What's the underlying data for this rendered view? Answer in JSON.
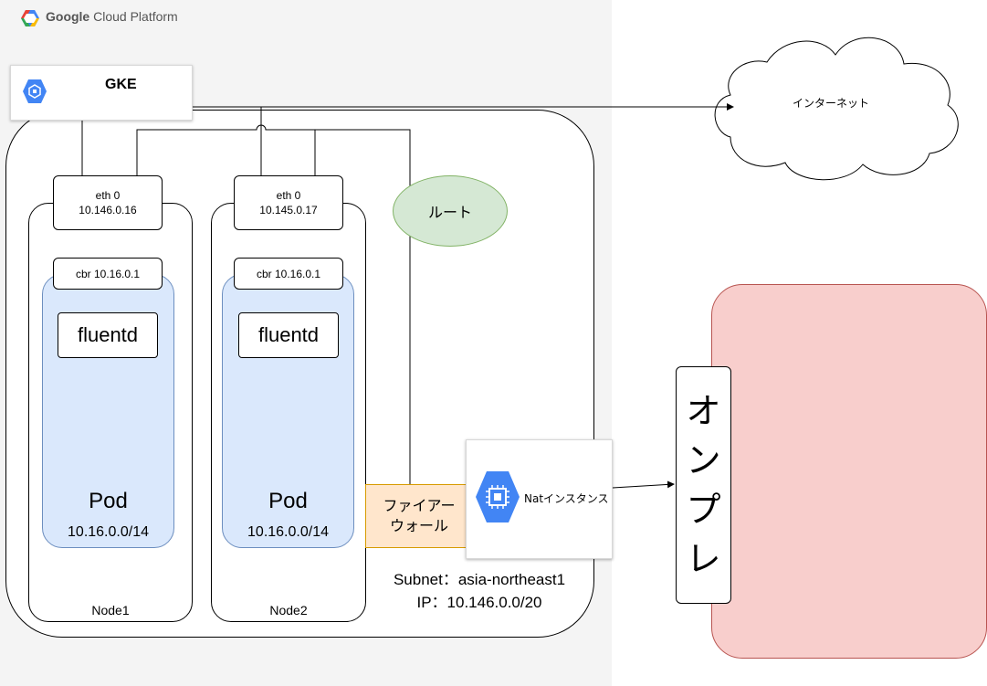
{
  "platform": {
    "brand": "Google",
    "name": "Cloud Platform"
  },
  "gke": {
    "label": "GKE"
  },
  "internet": {
    "label": "インターネット"
  },
  "route": {
    "label": "ルート"
  },
  "firewall": {
    "line1": "ファイアー",
    "line2": "ウォール"
  },
  "nat": {
    "label": "Natインスタンス"
  },
  "subnet": {
    "line1": "Subnet：asia-northeast1",
    "line2": "IP：10.146.0.0/20"
  },
  "onprem": {
    "chars": [
      "オ",
      "ン",
      "プ",
      "レ"
    ]
  },
  "nodes": [
    {
      "name": "Node1",
      "eth_title": "eth 0",
      "eth_ip": "10.146.0.16",
      "cbr": "cbr 10.16.0.1",
      "app": "fluentd",
      "pod": "Pod",
      "pod_cidr": "10.16.0.0/14"
    },
    {
      "name": "Node2",
      "eth_title": "eth 0",
      "eth_ip": "10.145.0.17",
      "cbr": "cbr 10.16.0.1",
      "app": "fluentd",
      "pod": "Pod",
      "pod_cidr": "10.16.0.0/14"
    }
  ],
  "colors": {
    "gcp_background": "#f4f4f4",
    "pod_fill": "#dae8fc",
    "route_fill": "#d5e8d4",
    "firewall_fill": "#ffe6cc",
    "onprem_fill": "#f8cecc",
    "gcp_blue": "#4285f4"
  }
}
